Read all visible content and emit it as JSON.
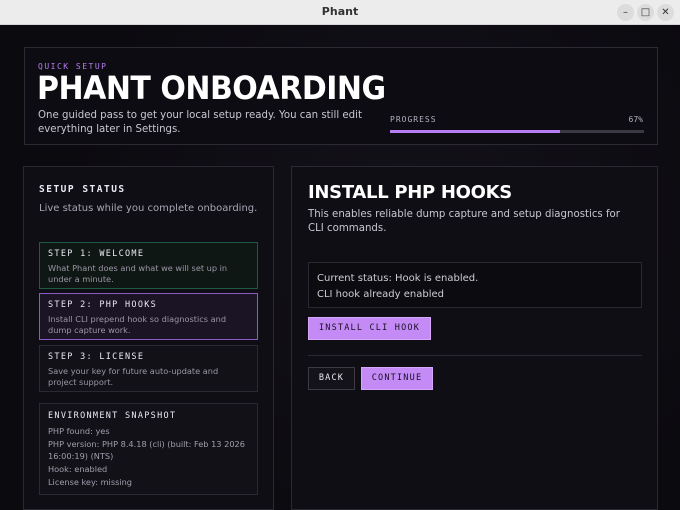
{
  "window": {
    "title": "Phant"
  },
  "hero": {
    "eyebrow": "QUICK SETUP",
    "title": "PHANT ONBOARDING",
    "description": "One guided pass to get your local setup ready. You can still edit everything later in Settings.",
    "progress_label": "PROGRESS",
    "progress_text": "67%",
    "progress_value": 0.67
  },
  "setup_status": {
    "heading": "SETUP STATUS",
    "subtitle": "Live status while you complete onboarding.",
    "steps": [
      {
        "title": "STEP 1: WELCOME",
        "description": "What Phant does and what we will set up in under a minute.",
        "state": "done"
      },
      {
        "title": "STEP 2: PHP HOOKS",
        "description": "Install CLI prepend hook so diagnostics and dump capture work.",
        "state": "active"
      },
      {
        "title": "STEP 3: LICENSE",
        "description": "Save your key for future auto-update and project support.",
        "state": "pending"
      }
    ],
    "environment": {
      "heading": "ENVIRONMENT SNAPSHOT",
      "rows": [
        "PHP found: yes",
        "PHP version: PHP 8.4.18 (cli) (built: Feb 13 2026 16:00:19) (NTS)",
        "Hook: enabled",
        "License key: missing"
      ]
    }
  },
  "panel": {
    "title": "INSTALL PHP HOOKS",
    "description": "This enables reliable dump capture and setup diagnostics for CLI commands.",
    "status_lines": [
      "Current status: Hook is enabled.",
      "CLI hook already enabled"
    ],
    "install_label": "INSTALL CLI HOOK",
    "back_label": "BACK",
    "continue_label": "CONTINUE"
  },
  "colors": {
    "accent": "#c48af5",
    "done_border": "#1f5a42",
    "active_border": "#8a5bc4"
  }
}
